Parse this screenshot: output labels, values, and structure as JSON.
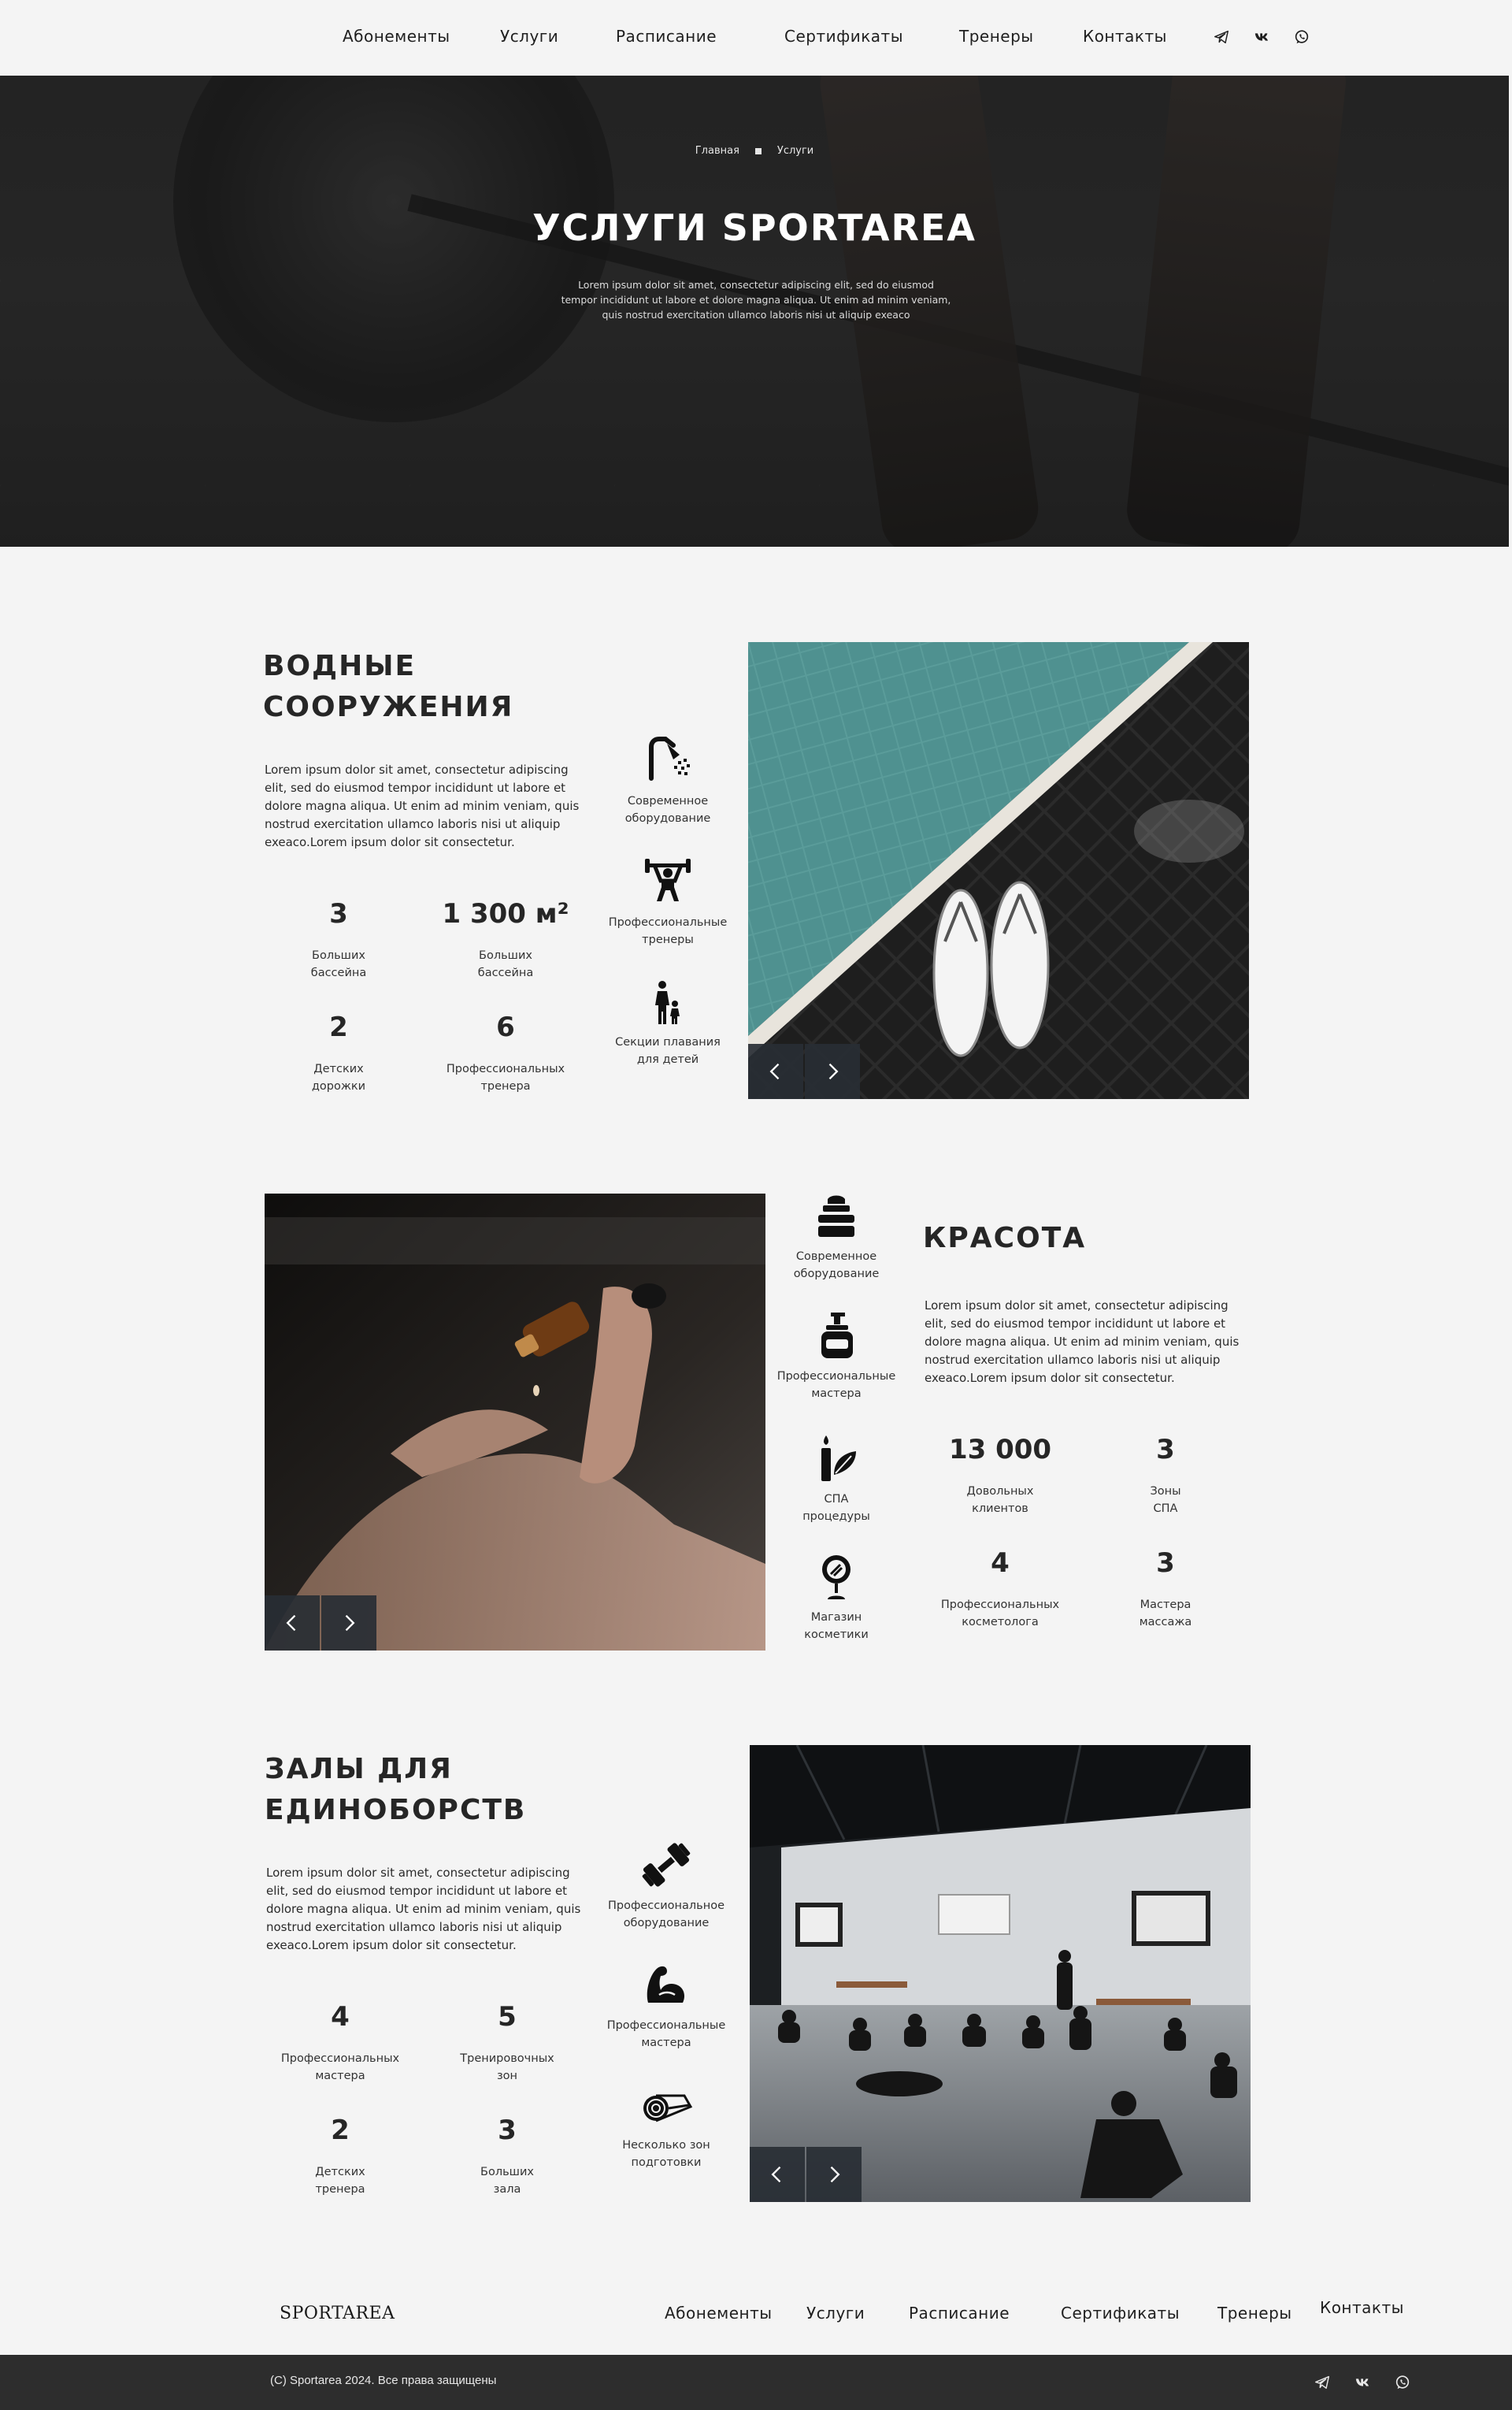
{
  "nav": {
    "items": [
      "Абонементы",
      "Услуги",
      "Расписание",
      "Сертификаты",
      "Тренеры",
      "Контакты"
    ],
    "social": [
      "telegram-icon",
      "vk-icon",
      "whatsapp-icon"
    ]
  },
  "hero": {
    "breadcrumb": [
      "Главная",
      "Услуги"
    ],
    "title": "УСЛУГИ SPORTAREA",
    "subtitle": "Lorem ipsum dolor sit amet, consectetur adipiscing elit, sed do eiusmod tempor incididunt ut labore et dolore magna aliqua. Ut enim ad minim veniam, quis nostrud exercitation ullamco laboris nisi ut aliquip exeaco"
  },
  "water": {
    "title_line1": "ВОДНЫЕ",
    "title_line2": "СООРУЖЕНИЯ",
    "text": "Lorem ipsum dolor sit amet, consectetur adipiscing elit, sed do eiusmod tempor incididunt ut labore et dolore magna aliqua. Ut enim ad minim veniam, quis nostrud exercitation ullamco laboris nisi ut aliquip exeaco.Lorem ipsum dolor sit consectetur.",
    "stats": [
      {
        "num": "3",
        "l1": "Больших",
        "l2": "бассейна"
      },
      {
        "num": "1 300 м²",
        "l1": "Больших",
        "l2": "бассейна"
      },
      {
        "num": "2",
        "l1": "Детских",
        "l2": "дорожки"
      },
      {
        "num": "6",
        "l1": "Профессиональных",
        "l2": "тренера"
      }
    ],
    "features": [
      {
        "icon": "shower-icon",
        "l1": "Современное",
        "l2": "оборудование"
      },
      {
        "icon": "weightlifter-icon",
        "l1": "Профессиональные",
        "l2": "тренеры"
      },
      {
        "icon": "parent-child-icon",
        "l1": "Секции плавания",
        "l2": "для детей"
      }
    ]
  },
  "beauty": {
    "title": "КРАСОТА",
    "text": "Lorem ipsum dolor sit amet, consectetur adipiscing elit, sed do eiusmod tempor incididunt ut labore et dolore magna aliqua. Ut enim ad minim veniam, quis nostrud exercitation ullamco laboris nisi ut aliquip exeaco.Lorem ipsum dolor sit consectetur.",
    "stats": [
      {
        "num": "13 000",
        "l1": "Довольных",
        "l2": "клиентов"
      },
      {
        "num": "3",
        "l1": "Зоны",
        "l2": "СПА"
      },
      {
        "num": "4",
        "l1": "Профессиональных",
        "l2": "косметолога"
      },
      {
        "num": "3",
        "l1": "Мастера",
        "l2": "массажа"
      }
    ],
    "features": [
      {
        "icon": "cream-jar-icon",
        "l1": "Современное",
        "l2": "оборудование"
      },
      {
        "icon": "dispenser-icon",
        "l1": "Профессиональные",
        "l2": "мастера"
      },
      {
        "icon": "candle-leaf-icon",
        "l1": "СПА",
        "l2": "процедуры"
      },
      {
        "icon": "mirror-icon",
        "l1": "Магазин",
        "l2": "косметики"
      }
    ]
  },
  "martial": {
    "title_line1": "ЗАЛЫ ДЛЯ",
    "title_line2": "ЕДИНОБОРСТВ",
    "text": "Lorem ipsum dolor sit amet, consectetur adipiscing elit, sed do eiusmod tempor incididunt ut labore et dolore magna aliqua. Ut enim ad minim veniam, quis nostrud exercitation ullamco laboris nisi ut aliquip exeaco.Lorem ipsum dolor sit consectetur.",
    "stats": [
      {
        "num": "4",
        "l1": "Профессиональных",
        "l2": "мастера"
      },
      {
        "num": "5",
        "l1": "Тренировочных",
        "l2": "зон"
      },
      {
        "num": "2",
        "l1": "Детских",
        "l2": "тренера"
      },
      {
        "num": "3",
        "l1": "Больших",
        "l2": "зала"
      }
    ],
    "features": [
      {
        "icon": "dumbbell-icon",
        "l1": "Профессиональное",
        "l2": "оборудование"
      },
      {
        "icon": "bicep-icon",
        "l1": "Профессиональные",
        "l2": "мастера"
      },
      {
        "icon": "mat-roll-icon",
        "l1": "Несколько зон",
        "l2": "подготовки"
      }
    ]
  },
  "footer": {
    "logo": "SPORTAREA",
    "items": [
      "Абонементы",
      "Услуги",
      "Расписание",
      "Сертификаты",
      "Тренеры",
      "Контакты"
    ],
    "copyright": "(C) Sportarea 2024. Все права защищены"
  },
  "colors": {
    "background": "#f4f4f4",
    "dark": "#2d2d2d",
    "slider_button": "#282e34"
  }
}
